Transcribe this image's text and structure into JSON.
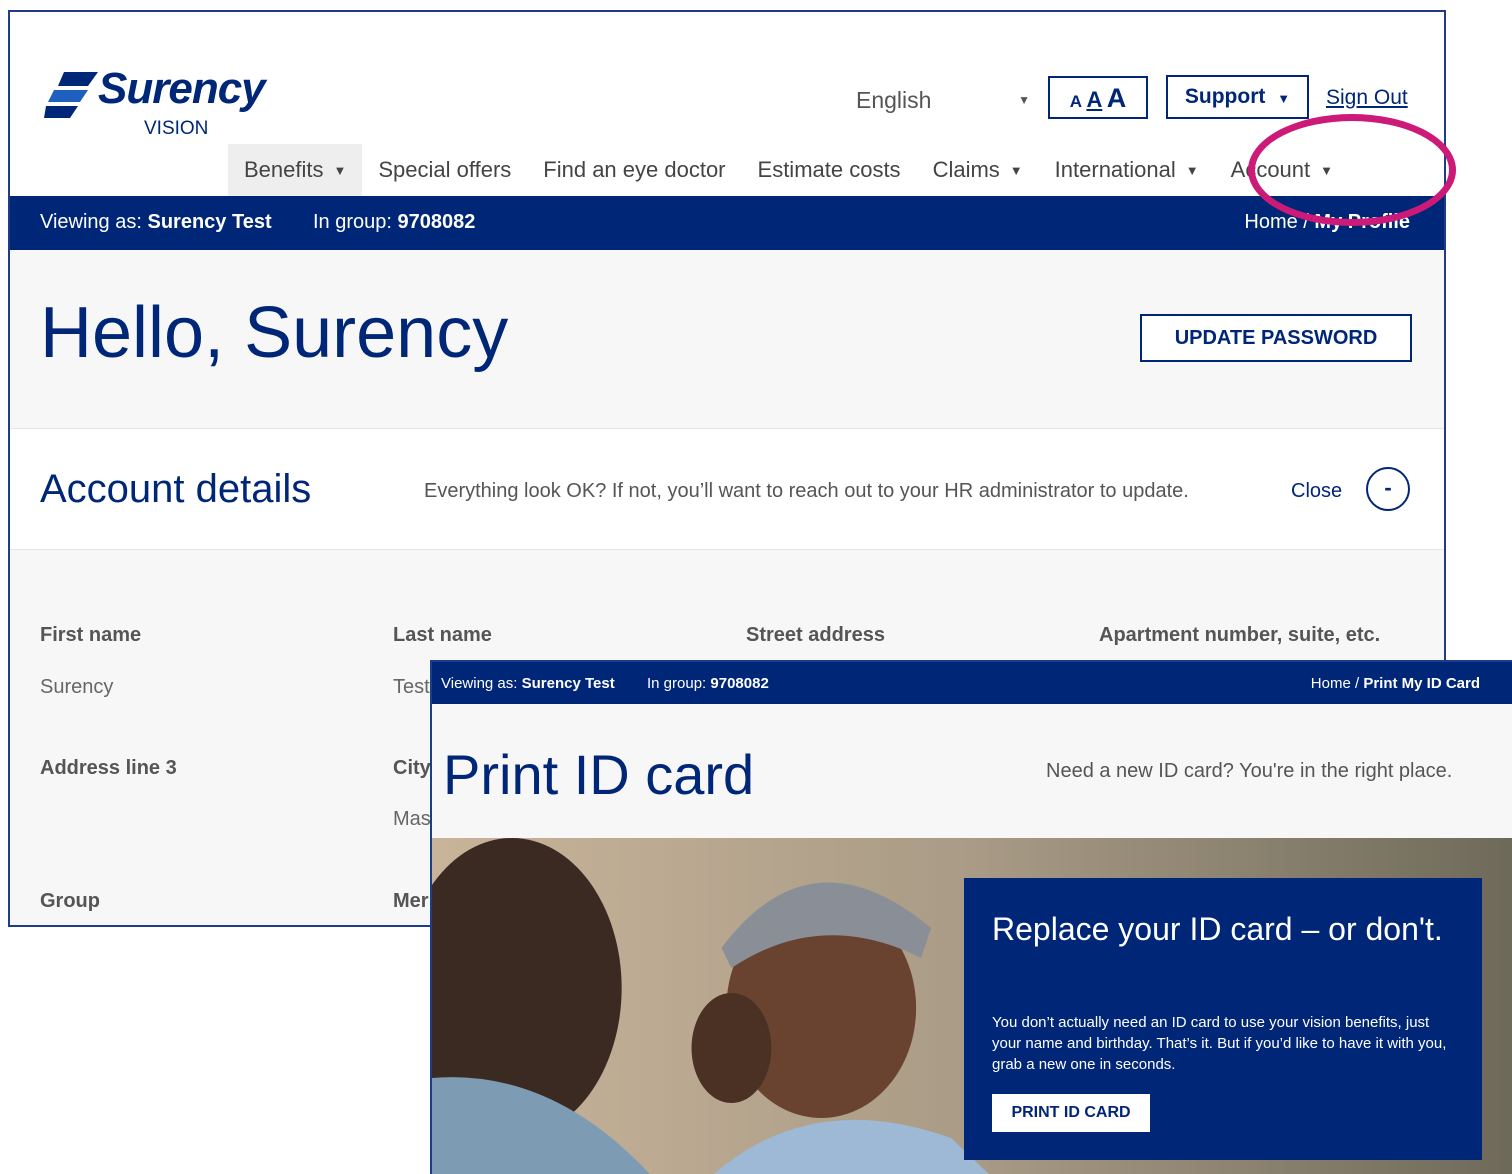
{
  "profile_window": {
    "logo": {
      "brand": "Surency",
      "sub": "VISION"
    },
    "utility": {
      "language": "English",
      "textsize_labels": [
        "A",
        "A",
        "A"
      ],
      "support_label": "Support",
      "signout_label": "Sign Out"
    },
    "nav": [
      {
        "label": "Benefits",
        "dropdown": true
      },
      {
        "label": "Special offers",
        "dropdown": false
      },
      {
        "label": "Find an eye doctor",
        "dropdown": false
      },
      {
        "label": "Estimate costs",
        "dropdown": false
      },
      {
        "label": "Claims",
        "dropdown": true
      },
      {
        "label": "International",
        "dropdown": true
      },
      {
        "label": "Account",
        "dropdown": true
      }
    ],
    "context": {
      "viewing_label": "Viewing as:",
      "viewing_name": "Surency Test",
      "group_label": "In group:",
      "group_number": "9708082",
      "breadcrumb_home": "Home /",
      "breadcrumb_current": "My Profile"
    },
    "hello": {
      "title": "Hello, Surency",
      "update_password": "UPDATE PASSWORD"
    },
    "account_details": {
      "title": "Account details",
      "note": "Everything look OK? If not, you’ll want to reach out to your HR administrator to update.",
      "close": "Close",
      "collapse_symbol": "-"
    },
    "fields": {
      "first_name_label": "First name",
      "first_name_value": "Surency",
      "last_name_label": "Last name",
      "last_name_value": "Test",
      "street_label": "Street address",
      "apt_label": "Apartment number, suite, etc.",
      "address3_label": "Address line 3",
      "city_label": "City",
      "city_value_partial": "Mas",
      "group_label": "Group",
      "member_label_partial": "Mer"
    }
  },
  "print_window": {
    "context": {
      "viewing_label": "Viewing as:",
      "viewing_name": "Surency Test",
      "group_label": "In group:",
      "group_number": "9708082",
      "breadcrumb_home": "Home /",
      "breadcrumb_current": "Print My ID Card"
    },
    "title": "Print ID card",
    "subtitle": "Need a new ID card?  You're in the right place.",
    "promo": {
      "title": "Replace your ID card – or don't.",
      "body": "You don’t actually need an ID card to use your vision benefits, just your name and birthday. That’s it. But if you’d like to have it with you, grab a new one in seconds.",
      "button": "PRINT ID CARD"
    }
  },
  "colors": {
    "brand_navy": "#002677",
    "highlight": "#cc1a78"
  },
  "icons": [
    "surency-logo-icon",
    "chevron-down-icon",
    "caret-down-icon",
    "minus-icon"
  ]
}
